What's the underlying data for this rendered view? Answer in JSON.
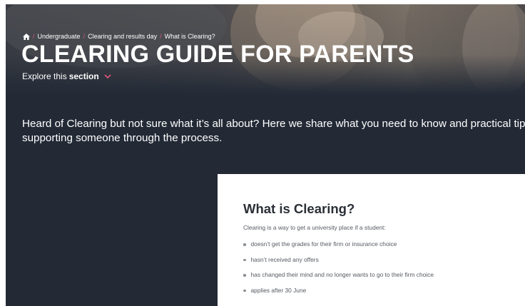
{
  "breadcrumb": {
    "items": [
      "Undergraduate",
      "Clearing and results day",
      "What is Clearing?"
    ],
    "separator": "/"
  },
  "hero": {
    "title": "CLEARING GUIDE FOR PARENTS",
    "explore_prefix": "Explore this",
    "explore_bold": "section"
  },
  "intro": {
    "line1": "Heard of Clearing but not sure what it’s all about? Here we share what you need to know and practical tips for",
    "line2": "supporting someone through the process."
  },
  "card": {
    "heading": "What is Clearing?",
    "lead": "Clearing is a way to get a university place if a student:",
    "bullets": [
      "doesn’t get the grades for their firm or insurance choice",
      "hasn’t received any offers",
      "has changed their mind and no longer wants to go to their firm choice",
      "applies after 30 June"
    ]
  },
  "colors": {
    "background": "#232a36",
    "accent": "#e0567a",
    "card": "#ffffff",
    "heading": "#2b2f36"
  },
  "icons": {
    "home": "home-icon",
    "chevron": "chevron-down-icon",
    "bullet": "bullet-icon"
  }
}
